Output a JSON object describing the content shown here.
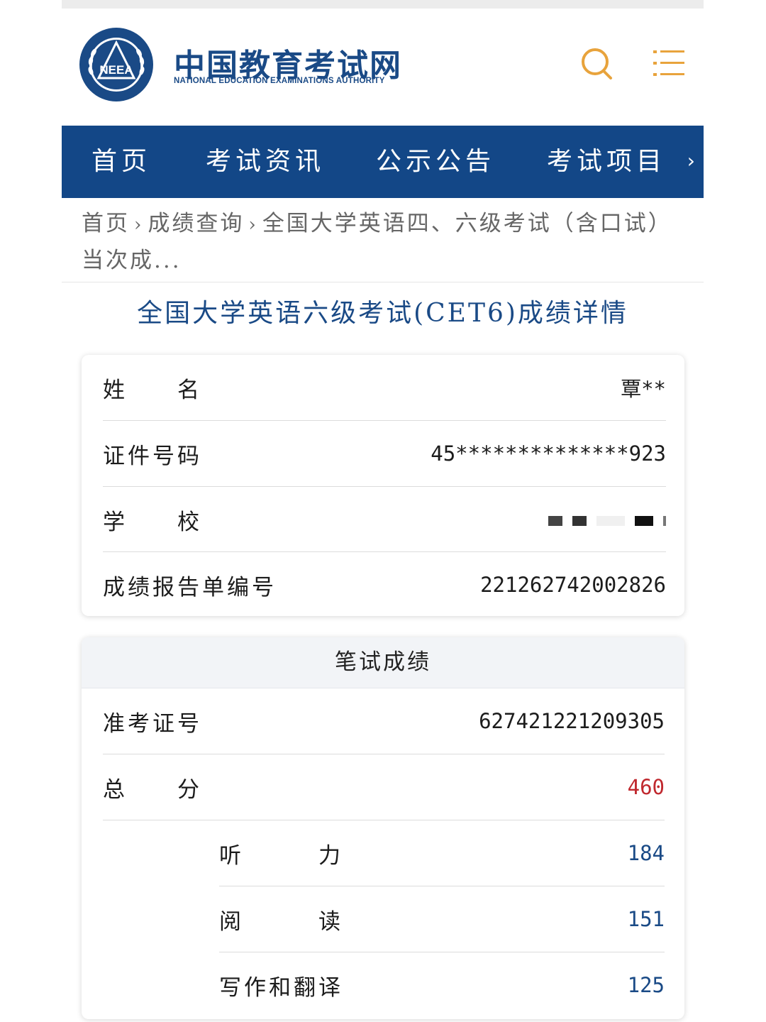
{
  "header": {
    "brand_cn": "中国教育考试网",
    "brand_en": "NATIONAL EDUCATION EXAMINATIONS AUTHORITY",
    "logo_text": "NEEA",
    "search_icon": "search-icon",
    "menu_icon": "menu-icon",
    "accent_color": "#E8A33C",
    "brand_color": "#1A4A86"
  },
  "nav": {
    "items": [
      "首页",
      "考试资讯",
      "公示公告",
      "考试项目"
    ],
    "more": "›",
    "background": "#134787"
  },
  "breadcrumb": {
    "items": [
      "首页",
      "成绩查询",
      "全国大学英语四、六级考试（含口试）当次成..."
    ],
    "separator": "›"
  },
  "page_title": "全国大学英语六级考试(CET6)成绩详情",
  "info_card": {
    "rows": [
      {
        "label": "姓　　名",
        "value": "覃**"
      },
      {
        "label": "证件号码",
        "value": "45**************923"
      },
      {
        "label": "学　　校",
        "value": ""
      },
      {
        "label": "成绩报告单编号",
        "value": "221262742002826"
      }
    ]
  },
  "score_card": {
    "title": "笔试成绩",
    "admission_label": "准考证号",
    "admission_value": "627421221209305",
    "total_label": "总　　分",
    "total_value": "460",
    "sub_scores": [
      {
        "label": "听　　　力",
        "value": "184"
      },
      {
        "label": "阅　　　读",
        "value": "151"
      },
      {
        "label": "写作和翻译",
        "value": "125"
      }
    ],
    "total_color": "#C0282E",
    "sub_color": "#1A4A86"
  }
}
